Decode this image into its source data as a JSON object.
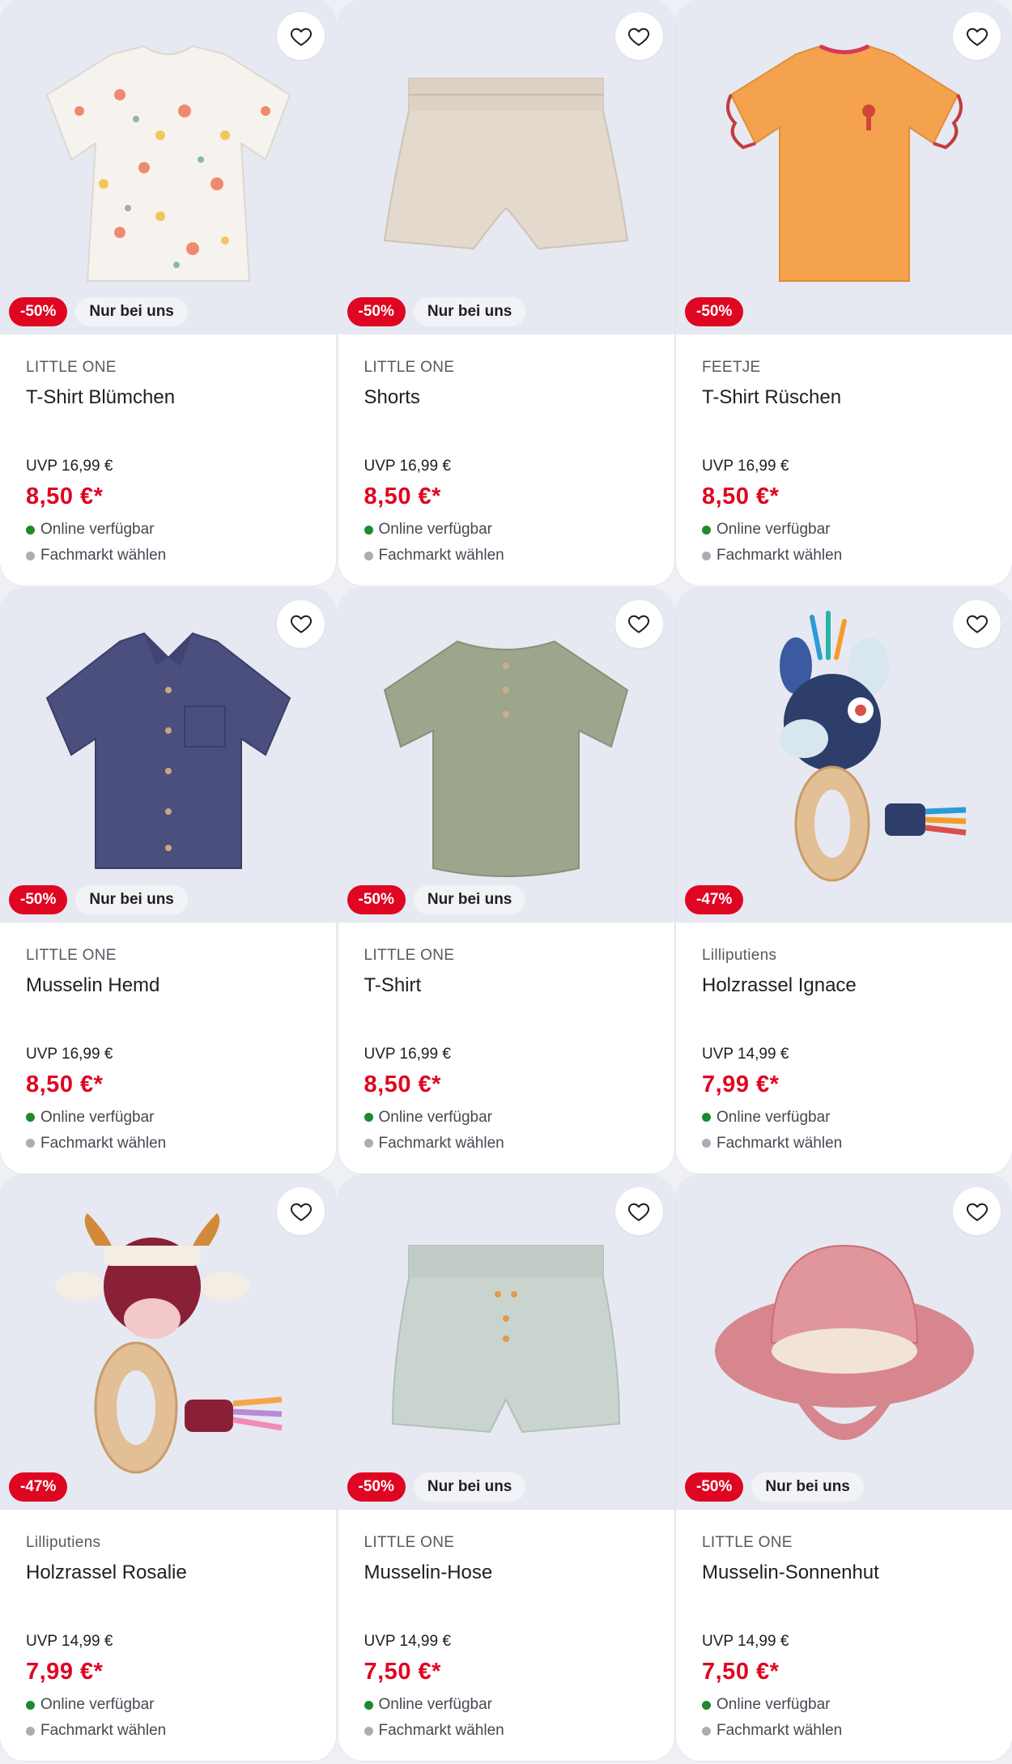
{
  "colors": {
    "sale": "#df0621",
    "available": "#1d8a2e",
    "store": "#a9adb4"
  },
  "products": [
    {
      "brand": "LITTLE ONE",
      "title": "T-Shirt Blümchen",
      "uvp": "UVP 16,99 €",
      "price": "8,50 €*",
      "discount": "-50%",
      "exclusive": "Nur bei uns",
      "availability": "Online verfügbar",
      "store": "Fachmarkt wählen",
      "image": "floral-shirt"
    },
    {
      "brand": "LITTLE ONE",
      "title": "Shorts",
      "uvp": "UVP 16,99 €",
      "price": "8,50 €*",
      "discount": "-50%",
      "exclusive": "Nur bei uns",
      "availability": "Online verfügbar",
      "store": "Fachmarkt wählen",
      "image": "beige-shorts"
    },
    {
      "brand": "FEETJE",
      "title": "T-Shirt Rüschen",
      "uvp": "UVP 16,99 €",
      "price": "8,50 €*",
      "discount": "-50%",
      "exclusive": "",
      "availability": "Online verfügbar",
      "store": "Fachmarkt wählen",
      "image": "orange-ruffle-shirt"
    },
    {
      "brand": "LITTLE ONE",
      "title": "Musselin Hemd",
      "uvp": "UVP 16,99 €",
      "price": "8,50 €*",
      "discount": "-50%",
      "exclusive": "Nur bei uns",
      "availability": "Online verfügbar",
      "store": "Fachmarkt wählen",
      "image": "navy-shirt"
    },
    {
      "brand": "LITTLE ONE",
      "title": "T-Shirt",
      "uvp": "UVP 16,99 €",
      "price": "8,50 €*",
      "discount": "-50%",
      "exclusive": "Nur bei uns",
      "availability": "Online verfügbar",
      "store": "Fachmarkt wählen",
      "image": "green-shirt"
    },
    {
      "brand": "Lilliputiens",
      "title": "Holzrassel Ignace",
      "uvp": "UVP 14,99 €",
      "price": "7,99 €*",
      "discount": "-47%",
      "exclusive": "",
      "availability": "Online verfügbar",
      "store": "Fachmarkt wählen",
      "image": "donkey-rattle"
    },
    {
      "brand": "Lilliputiens",
      "title": "Holzrassel Rosalie",
      "uvp": "UVP 14,99 €",
      "price": "7,99 €*",
      "discount": "-47%",
      "exclusive": "",
      "availability": "Online verfügbar",
      "store": "Fachmarkt wählen",
      "image": "cow-rattle"
    },
    {
      "brand": "LITTLE ONE",
      "title": "Musselin-Hose",
      "uvp": "UVP 14,99 €",
      "price": "7,50 €*",
      "discount": "-50%",
      "exclusive": "Nur bei uns",
      "availability": "Online verfügbar",
      "store": "Fachmarkt wählen",
      "image": "mint-shorts"
    },
    {
      "brand": "LITTLE ONE",
      "title": "Musselin-Sonnenhut",
      "uvp": "UVP 14,99 €",
      "price": "7,50 €*",
      "discount": "-50%",
      "exclusive": "Nur bei uns",
      "availability": "Online verfügbar",
      "store": "Fachmarkt wählen",
      "image": "pink-sunhat"
    }
  ]
}
